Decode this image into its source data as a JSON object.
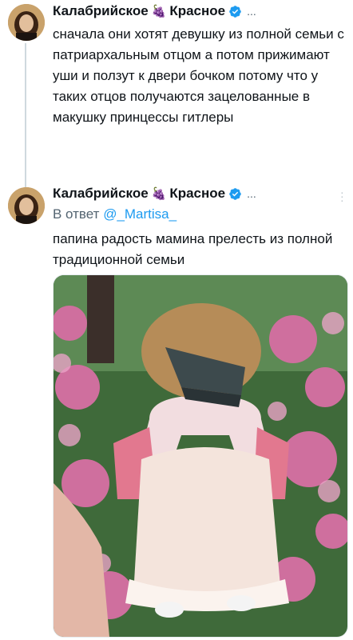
{
  "tweet1": {
    "author": "Калабрийское",
    "author_suffix": "Красное",
    "grape_icon": "grapes-emoji",
    "more_dots": "...",
    "text": "сначала они хотят девушку из полной семьи с патриархальным отцом а потом прижимают уши и ползут к двери бочком потому что у таких отцов получаются зацелованные в макушку принцессы гитлеры"
  },
  "tweet2": {
    "author": "Калабрийское",
    "author_suffix": "Красное",
    "more_dots": "...",
    "reply_prefix": "В ответ",
    "reply_handle": "@_Martisa_",
    "text": "папина радость мамина прелесть из полной традиционной семьи"
  },
  "colors": {
    "verified": "#1d9bf0",
    "link": "#1d9bf0",
    "secondary_text": "#536471",
    "thread_line": "#cfd9de"
  }
}
